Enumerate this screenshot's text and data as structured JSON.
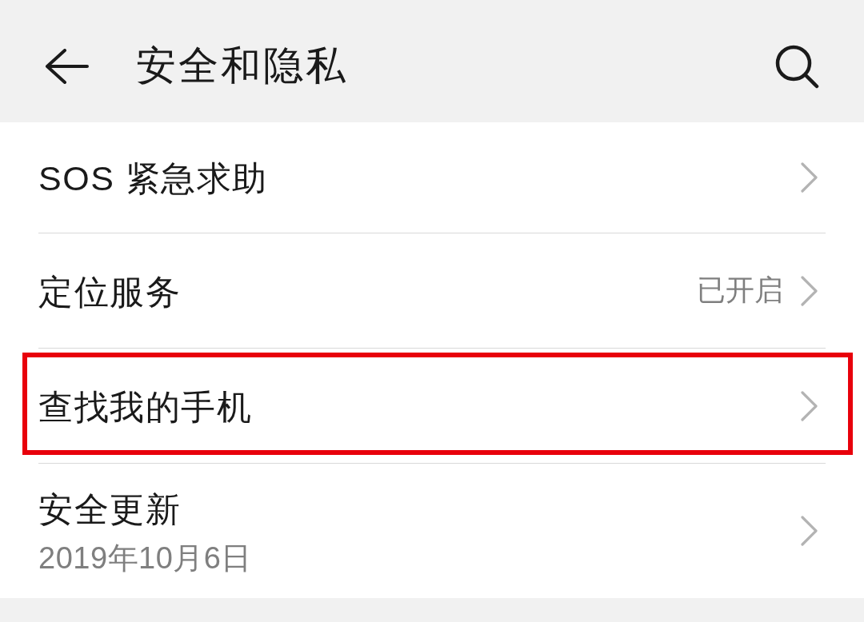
{
  "header": {
    "title": "安全和隐私"
  },
  "items": [
    {
      "title": "SOS 紧急求助",
      "highlighted": false
    },
    {
      "title": "定位服务",
      "value": "已开启",
      "highlighted": false
    },
    {
      "title": "查找我的手机",
      "highlighted": true
    },
    {
      "title": "安全更新",
      "subtitle": "2019年10月6日",
      "highlighted": false
    }
  ]
}
